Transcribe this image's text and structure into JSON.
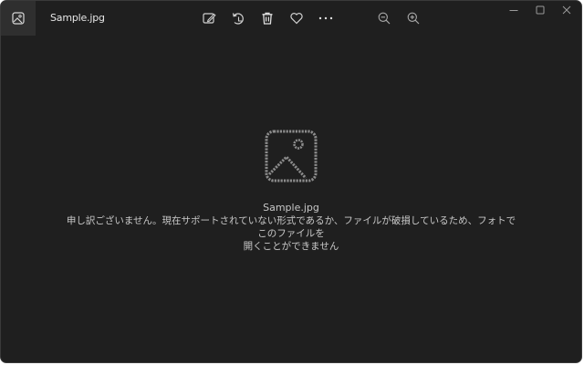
{
  "window": {
    "title": "Sample.jpg"
  },
  "toolbar": {
    "icons": [
      "edit-icon",
      "rotate-icon",
      "delete-icon",
      "favorite-icon",
      "more-icon",
      "zoom-out-icon",
      "zoom-in-icon"
    ]
  },
  "window_controls": {
    "icons": [
      "minimize-icon",
      "maximize-icon",
      "close-icon"
    ]
  },
  "content": {
    "filename": "Sample.jpg",
    "message_line1": "申し訳ございません。現在サポートされていない形式であるか、ファイルが破損しているため、フォトでこのファイルを",
    "message_line2": "開くことができません"
  },
  "colors": {
    "background": "#1f1f1f",
    "text": "#c8c8c8",
    "icon": "#d0d0d0"
  }
}
